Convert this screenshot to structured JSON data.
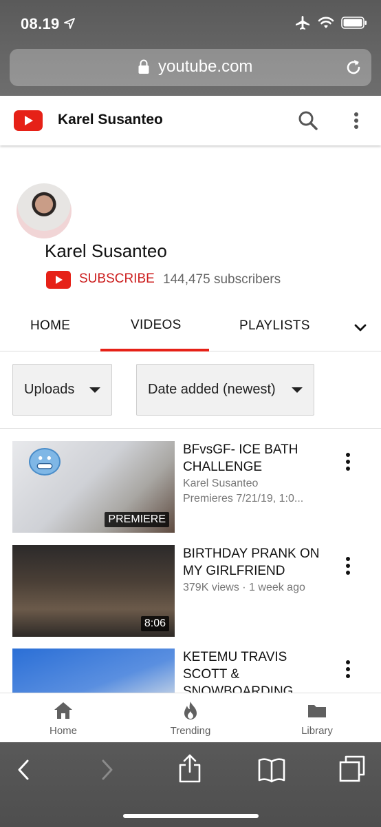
{
  "status_bar": {
    "time": "08.19",
    "icons": [
      "location-arrow-icon",
      "airplane-icon",
      "wifi-icon",
      "battery-icon"
    ]
  },
  "safari": {
    "url": "youtube.com",
    "bottom_toolbar": [
      "back-icon",
      "forward-icon",
      "share-icon",
      "bookmarks-icon",
      "tabs-icon"
    ]
  },
  "header": {
    "title": "Karel Susanteo",
    "icons": [
      "youtube-logo-icon",
      "search-icon",
      "more-vert-icon"
    ]
  },
  "channel": {
    "name": "Karel Susanteo",
    "subscribe_label": "SUBSCRIBE",
    "subscriber_count": "144,475 subscribers"
  },
  "tabs": [
    {
      "label": "HOME",
      "active": false
    },
    {
      "label": "VIDEOS",
      "active": true
    },
    {
      "label": "PLAYLISTS",
      "active": false
    }
  ],
  "filters": {
    "type": "Uploads",
    "sort": "Date added (newest)"
  },
  "videos": [
    {
      "title": "BFvsGF- ICE BATH CHALLENGE",
      "channel": "Karel Susanteo",
      "meta": "Premieres 7/21/19, 1:0...",
      "badge": "PREMIERE"
    },
    {
      "title": "BIRTHDAY PRANK ON MY GIRLFRIEND",
      "meta": "379K views · 1 week ago",
      "duration": "8:06"
    },
    {
      "title": "KETEMU TRAVIS SCOTT & SNOWBOARDING"
    }
  ],
  "bottom_nav": [
    {
      "label": "Home",
      "icon": "home-icon"
    },
    {
      "label": "Trending",
      "icon": "trending-flame-icon"
    },
    {
      "label": "Library",
      "icon": "library-folder-icon"
    }
  ],
  "colors": {
    "youtube_red": "#e62117",
    "subscribe_red": "#cc1e1e",
    "safari_chrome": "#5e5e5e"
  }
}
